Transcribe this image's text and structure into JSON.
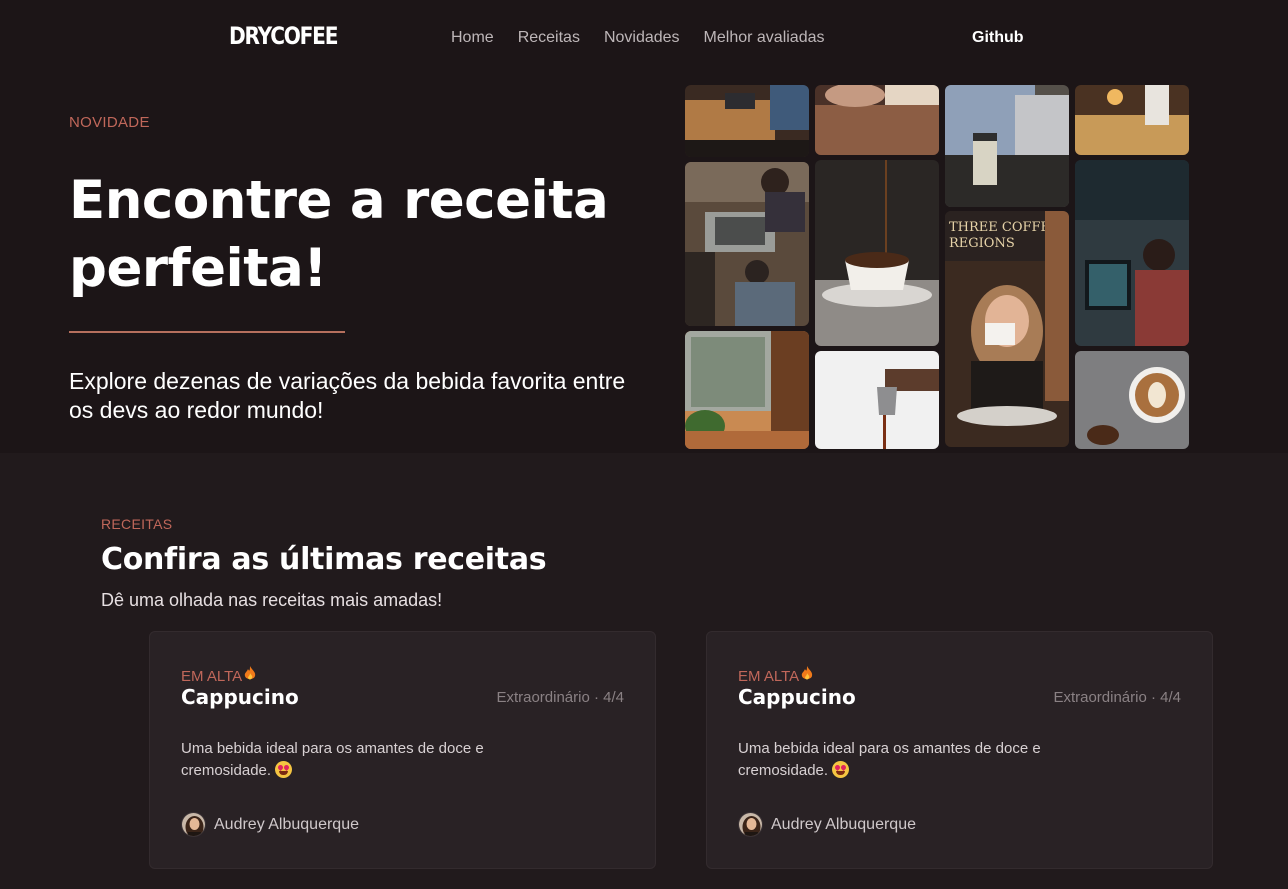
{
  "nav": {
    "logo": "DRYCOFEE",
    "links": [
      "Home",
      "Receitas",
      "Novidades",
      "Melhor avaliadas"
    ],
    "github": "Github"
  },
  "hero": {
    "eyebrow": "NOVIDADE",
    "title": "Encontre a receita perfeita!",
    "subtitle": "Explore dezenas de variações da bebida favorita entre os devs ao redor mundo!",
    "gallery_images": [
      "coffee-shop-laptop-table",
      "coffee-shop-counter",
      "man-laptop-coffee-cup",
      "barista-bar",
      "baristas-making-coffee",
      "coffee-pouring-into-cup",
      "woman-drinking-coffee",
      "developer-coding",
      "cafe-window-plants",
      "pouring-milk-jug",
      "latte-art"
    ]
  },
  "recipes": {
    "eyebrow": "RECEITAS",
    "title": "Confira as últimas receitas",
    "subtitle": "Dê uma olhada nas receitas mais amadas!",
    "cards": [
      {
        "badge": "EM ALTA",
        "badge_icon": "flame-icon",
        "title": "Cappucino",
        "rating": "Extraordinário · 4/4",
        "description": "Uma bebida ideal para os amantes de doce e cremosidade.",
        "description_emoji": "heart-eyes-emoji",
        "author": "Audrey Albuquerque"
      },
      {
        "badge": "EM ALTA",
        "badge_icon": "flame-icon",
        "title": "Cappucino",
        "rating": "Extraordinário · 4/4",
        "description": "Uma bebida ideal para os amantes de doce e cremosidade.",
        "description_emoji": "heart-eyes-emoji",
        "author": "Audrey Albuquerque"
      }
    ]
  },
  "colors": {
    "background": "#211a1c",
    "nav_background": "#1c1517",
    "accent": "#c0675a",
    "card_background": "#292225"
  }
}
